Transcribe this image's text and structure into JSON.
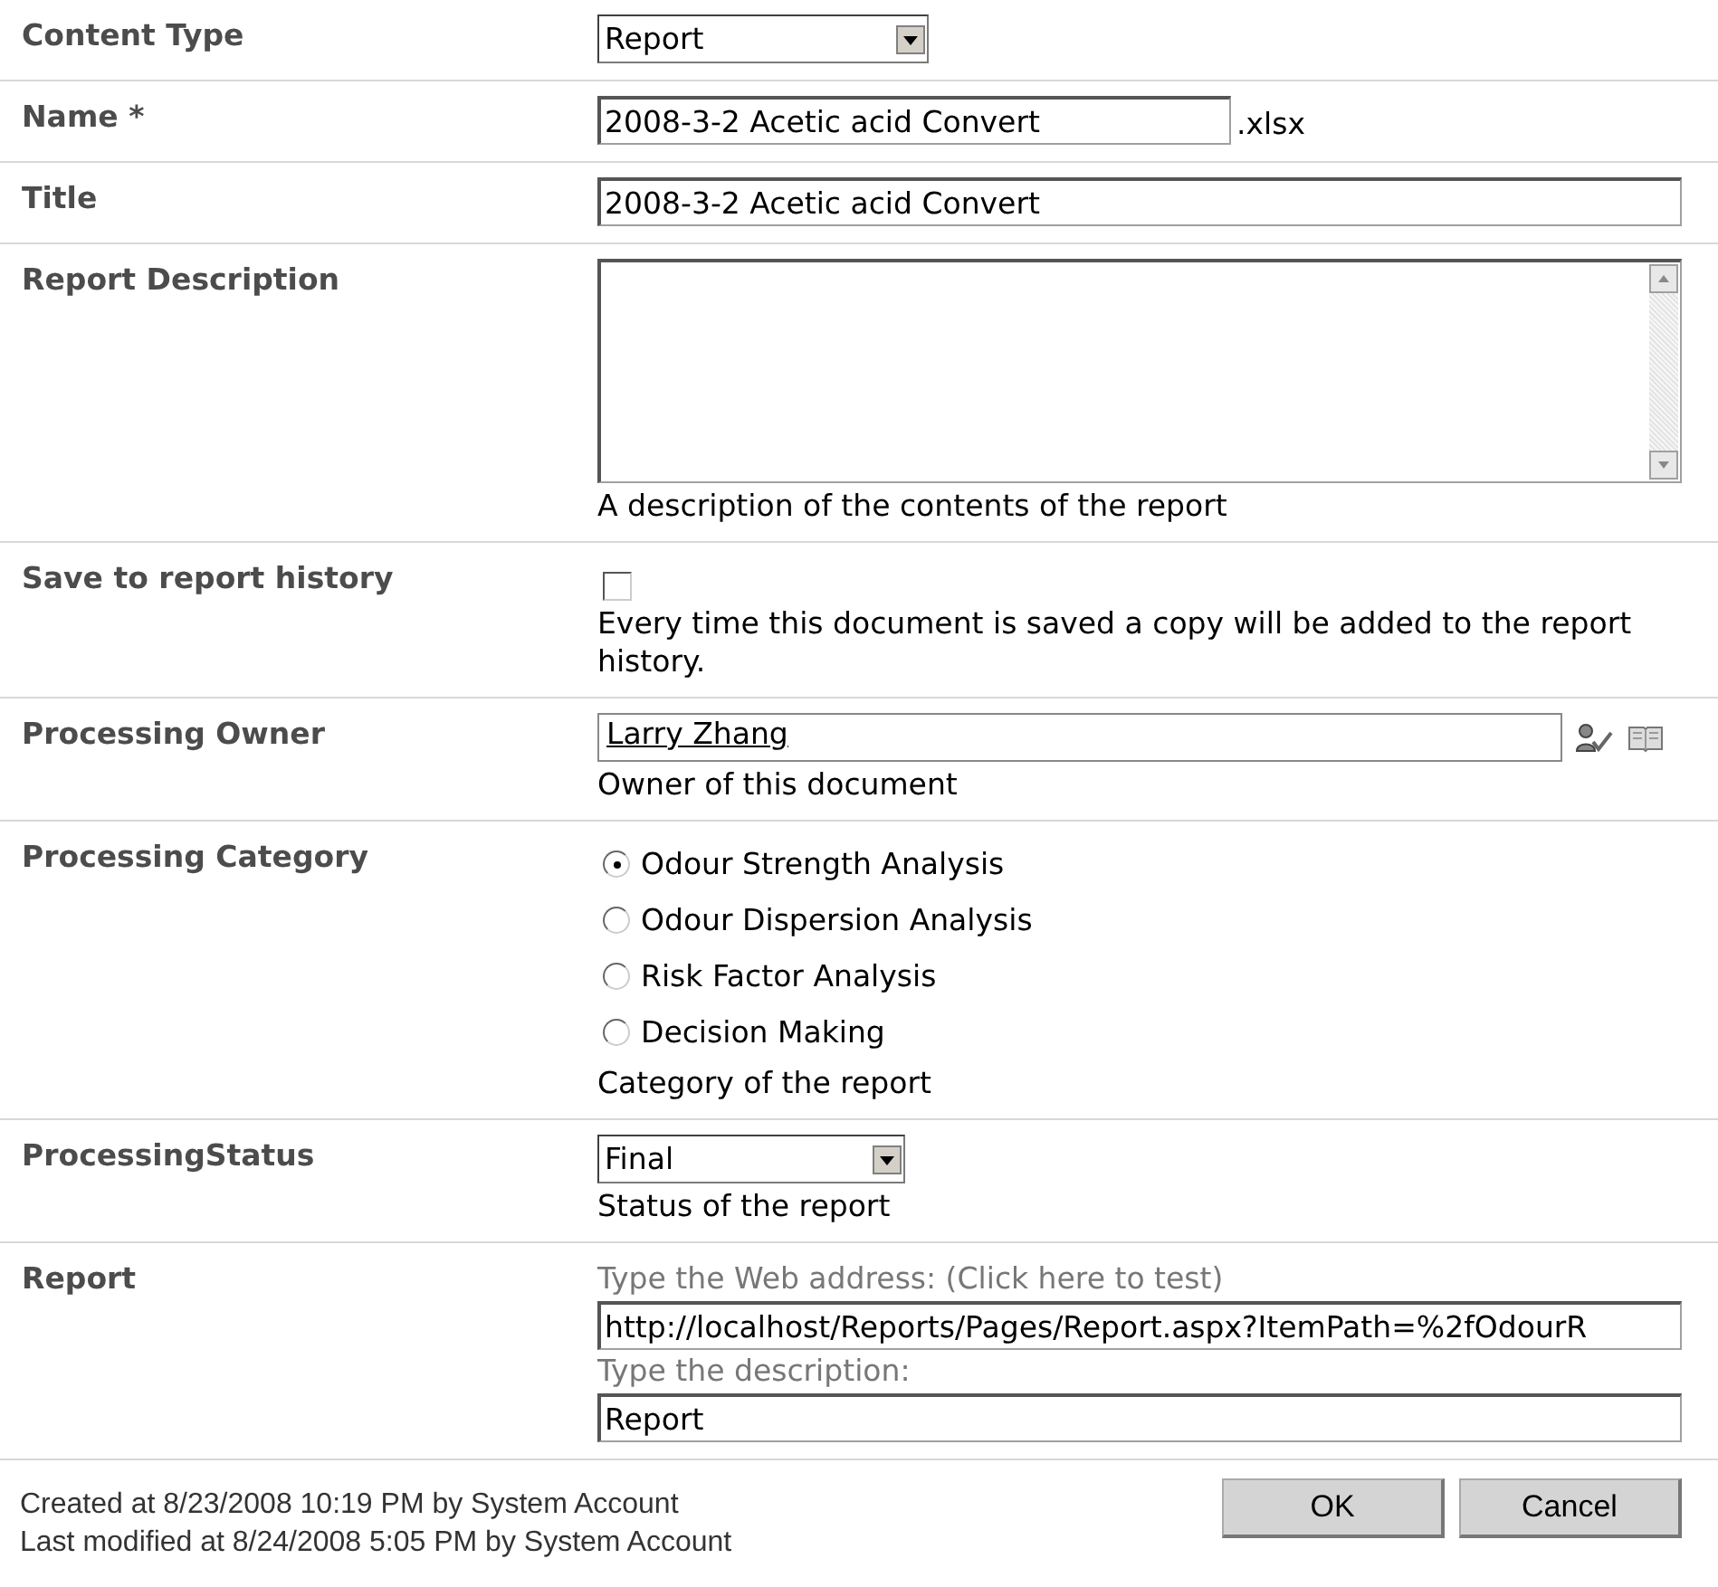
{
  "fields": [
    {
      "label": "Content Type",
      "kind": "select",
      "value": "Report"
    },
    {
      "label": "Name *",
      "kind": "text",
      "value": "2008-3-2 Acetic acid Convert",
      "suffix": ".xlsx"
    },
    {
      "label": "Title",
      "kind": "text",
      "value": "2008-3-2 Acetic acid Convert"
    },
    {
      "label": "Report Description",
      "kind": "textarea",
      "description": "A description of the contents of the report"
    },
    {
      "label": "Save to report history",
      "kind": "checkbox",
      "checked": false,
      "description": "Every time this document is saved a copy will be added to the report history."
    },
    {
      "label": "Processing Owner",
      "kind": "people",
      "value": "Larry Zhang",
      "description": "Owner of this document"
    },
    {
      "label": "Processing Category",
      "kind": "radio",
      "options": [
        {
          "label": "Odour Strength Analysis",
          "selected": true
        },
        {
          "label": "Odour Dispersion Analysis",
          "selected": false
        },
        {
          "label": "Risk Factor Analysis",
          "selected": false
        },
        {
          "label": "Decision Making",
          "selected": false
        }
      ],
      "description": "Category of the report"
    },
    {
      "label": "ProcessingStatus",
      "kind": "select",
      "value": "Final",
      "description": "Status of the report"
    },
    {
      "label": "Report",
      "kind": "link",
      "address_hint": "Type the Web address: (Click here to test)",
      "address": "http://localhost/Reports/Pages/Report.aspx?ItemPath=%2fOdourR",
      "description_hint": "Type the description:",
      "description_value": "Report"
    }
  ],
  "footer": {
    "lines": [
      "Created at 8/23/2008 10:19 PM  by System Account",
      "Last modified at 8/24/2008 5:05 PM  by System Account"
    ],
    "buttons": [
      "OK",
      "Cancel"
    ]
  }
}
